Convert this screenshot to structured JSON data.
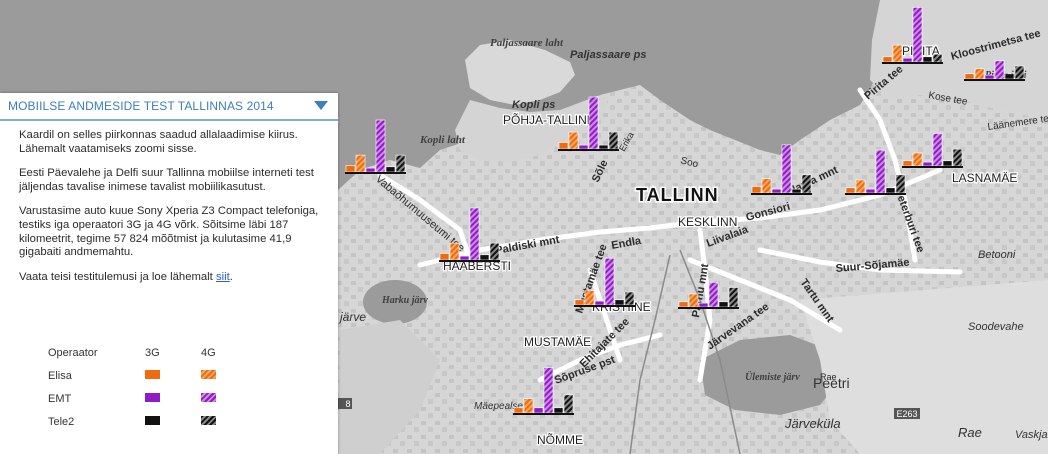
{
  "panel": {
    "title": "MOBIILSE ANDMESIDE TEST TALLINNAS 2014",
    "paragraphs": [
      "Kaardil on selles piirkonnas saadud allalaadimise kiirus. Lähemalt vaatamiseks zoomi sisse.",
      "Eesti Päevalehe ja Delfi suur Tallinna mobiilse interneti test jäljendas tavalise inimese tavalist mobiilikasutust.",
      "Varustasime auto kuue Sony Xperia Z3 Compact telefoniga, testiks iga operaatori 3G ja 4G võrk. Sõitsime läbi 187 kilomeetrit, tegime 57 824 mõõtmist ja kulutasime 41,9 gigabaiti andmemahtu."
    ],
    "more_text": "Vaata teisi testitulemusi ja loe lähemalt ",
    "more_link": "siit",
    "more_suffix": "."
  },
  "legend": {
    "header": {
      "operator": "Operaator",
      "g3": "3G",
      "g4": "4G"
    },
    "operators": [
      {
        "name": "Elisa",
        "color": "#f06a10"
      },
      {
        "name": "EMT",
        "color": "#8f1cc4"
      },
      {
        "name": "Tele2",
        "color": "#111111"
      }
    ]
  },
  "map_labels": {
    "districts": [
      "PÕHJA-TALLINN",
      "KESKLINN",
      "HAABERSTI",
      "KRISTIINE",
      "MUSTAMÄE",
      "NÕMME",
      "LASNAMÄE",
      "PIRITA"
    ],
    "city": "TALLINN",
    "water": [
      "Paljassaare laht",
      "Kopli laht",
      "Harku järv",
      "Ülemiste järv",
      "Pirita jõgi"
    ],
    "places": [
      "Paljassaare ps",
      "Kopli ps",
      "Peetri",
      "Järveküla",
      "Rae",
      "Soodevahe",
      "Vaskjala",
      "Betooni",
      "Mäepealse",
      "järve"
    ],
    "streets": [
      "Kloostrimetsa tee",
      "Pirita tee",
      "Kose tee",
      "Läänemere tee",
      "Sõle",
      "Erika",
      "Soo",
      "Paldiski mnt",
      "Endla",
      "Liivalaia",
      "Gonsiori",
      "Tartu mnt",
      "Suur-Sõjamäe",
      "Mustamäe tee",
      "Pärnu mnt",
      "Järvevana tee",
      "Sõpruse pst",
      "Ehitajate tee",
      "Narva mnt",
      "Vabaõhumuuseumi tee",
      "Peterburi tee",
      "Rae"
    ],
    "road_badges": [
      "E263",
      "8"
    ]
  },
  "chart_data": [
    {
      "type": "bar",
      "region": "PÕHJA-TALLINN",
      "categories": [
        "Elisa 3G",
        "Elisa 4G",
        "EMT 3G",
        "EMT 4G",
        "Tele2 3G",
        "Tele2 4G"
      ],
      "values": [
        5,
        13,
        3,
        40,
        3,
        13
      ]
    },
    {
      "type": "bar",
      "region": "HAABERSTI (north-west)",
      "categories": [
        "Elisa 3G",
        "Elisa 4G",
        "EMT 3G",
        "EMT 4G",
        "Tele2 3G",
        "Tele2 4G"
      ],
      "values": [
        5,
        13,
        3,
        40,
        4,
        13
      ]
    },
    {
      "type": "bar",
      "region": "HAABERSTI",
      "categories": [
        "Elisa 3G",
        "Elisa 4G",
        "EMT 3G",
        "EMT 4G",
        "Tele2 3G",
        "Tele2 4G"
      ],
      "values": [
        5,
        13,
        3,
        40,
        4,
        13
      ]
    },
    {
      "type": "bar",
      "region": "KRISTIINE",
      "categories": [
        "Elisa 3G",
        "Elisa 4G",
        "EMT 3G",
        "EMT 4G",
        "Tele2 3G",
        "Tele2 4G"
      ],
      "values": [
        4,
        11,
        3,
        36,
        4,
        10
      ]
    },
    {
      "type": "bar",
      "region": "KESKLINN",
      "categories": [
        "Elisa 3G",
        "Elisa 4G",
        "EMT 3G",
        "EMT 4G",
        "Tele2 3G",
        "Tele2 4G"
      ],
      "values": [
        4,
        10,
        3,
        19,
        4,
        15
      ]
    },
    {
      "type": "bar",
      "region": "NÕMME",
      "categories": [
        "Elisa 3G",
        "Elisa 4G",
        "EMT 3G",
        "EMT 4G",
        "Tele2 3G",
        "Tele2 4G"
      ],
      "values": [
        4,
        11,
        4,
        35,
        4,
        14
      ]
    },
    {
      "type": "bar",
      "region": "KESKLINN (east)",
      "categories": [
        "Elisa 3G",
        "Elisa 4G",
        "EMT 3G",
        "EMT 4G",
        "Tele2 3G",
        "Tele2 4G"
      ],
      "values": [
        5,
        11,
        3,
        37,
        3,
        14
      ]
    },
    {
      "type": "bar",
      "region": "LASNAMÄE (west)",
      "categories": [
        "Elisa 3G",
        "Elisa 4G",
        "EMT 3G",
        "EMT 4G",
        "Tele2 3G",
        "Tele2 4G"
      ],
      "values": [
        4,
        10,
        3,
        33,
        4,
        14
      ]
    },
    {
      "type": "bar",
      "region": "LASNAMÄE",
      "categories": [
        "Elisa 3G",
        "Elisa 4G",
        "EMT 3G",
        "EMT 4G",
        "Tele2 3G",
        "Tele2 4G"
      ],
      "values": [
        4,
        10,
        3,
        25,
        4,
        13
      ]
    },
    {
      "type": "bar",
      "region": "PIRITA",
      "categories": [
        "Elisa 3G",
        "Elisa 4G",
        "EMT 3G",
        "EMT 4G",
        "Tele2 3G",
        "Tele2 4G"
      ],
      "values": [
        4,
        13,
        3,
        42,
        4,
        6
      ]
    },
    {
      "type": "bar",
      "region": "PIRITA (east)",
      "categories": [
        "Elisa 3G",
        "Elisa 4G",
        "EMT 3G",
        "EMT 4G",
        "Tele2 3G",
        "Tele2 4G"
      ],
      "values": [
        4,
        8,
        3,
        14,
        4,
        10
      ]
    }
  ]
}
